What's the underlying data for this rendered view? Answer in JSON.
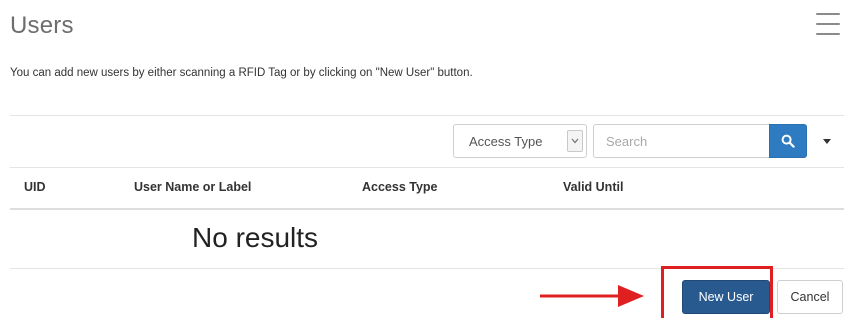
{
  "header": {
    "title": "Users",
    "menu_icon": "hamburger-menu-icon"
  },
  "instructions": "You can add new users by either scanning a RFID Tag or by clicking on \"New User\" button.",
  "toolbar": {
    "access_type_label": "Access Type",
    "dropdown_icon": "chevron-down-icon",
    "search_placeholder": "Search",
    "search_icon": "magnifier-icon",
    "caret_icon": "caret-down-icon",
    "search_button_color": "#2e7bc1"
  },
  "table": {
    "columns": [
      "UID",
      "User Name or Label",
      "Access Type",
      "Valid Until"
    ],
    "rows": [],
    "empty_message": "No results"
  },
  "footer": {
    "new_user_label": "New User",
    "cancel_label": "Cancel",
    "new_user_color": "#285a8f"
  },
  "annotation": {
    "highlight_color": "#e02020",
    "arrow_icon": "right-arrow-icon"
  }
}
